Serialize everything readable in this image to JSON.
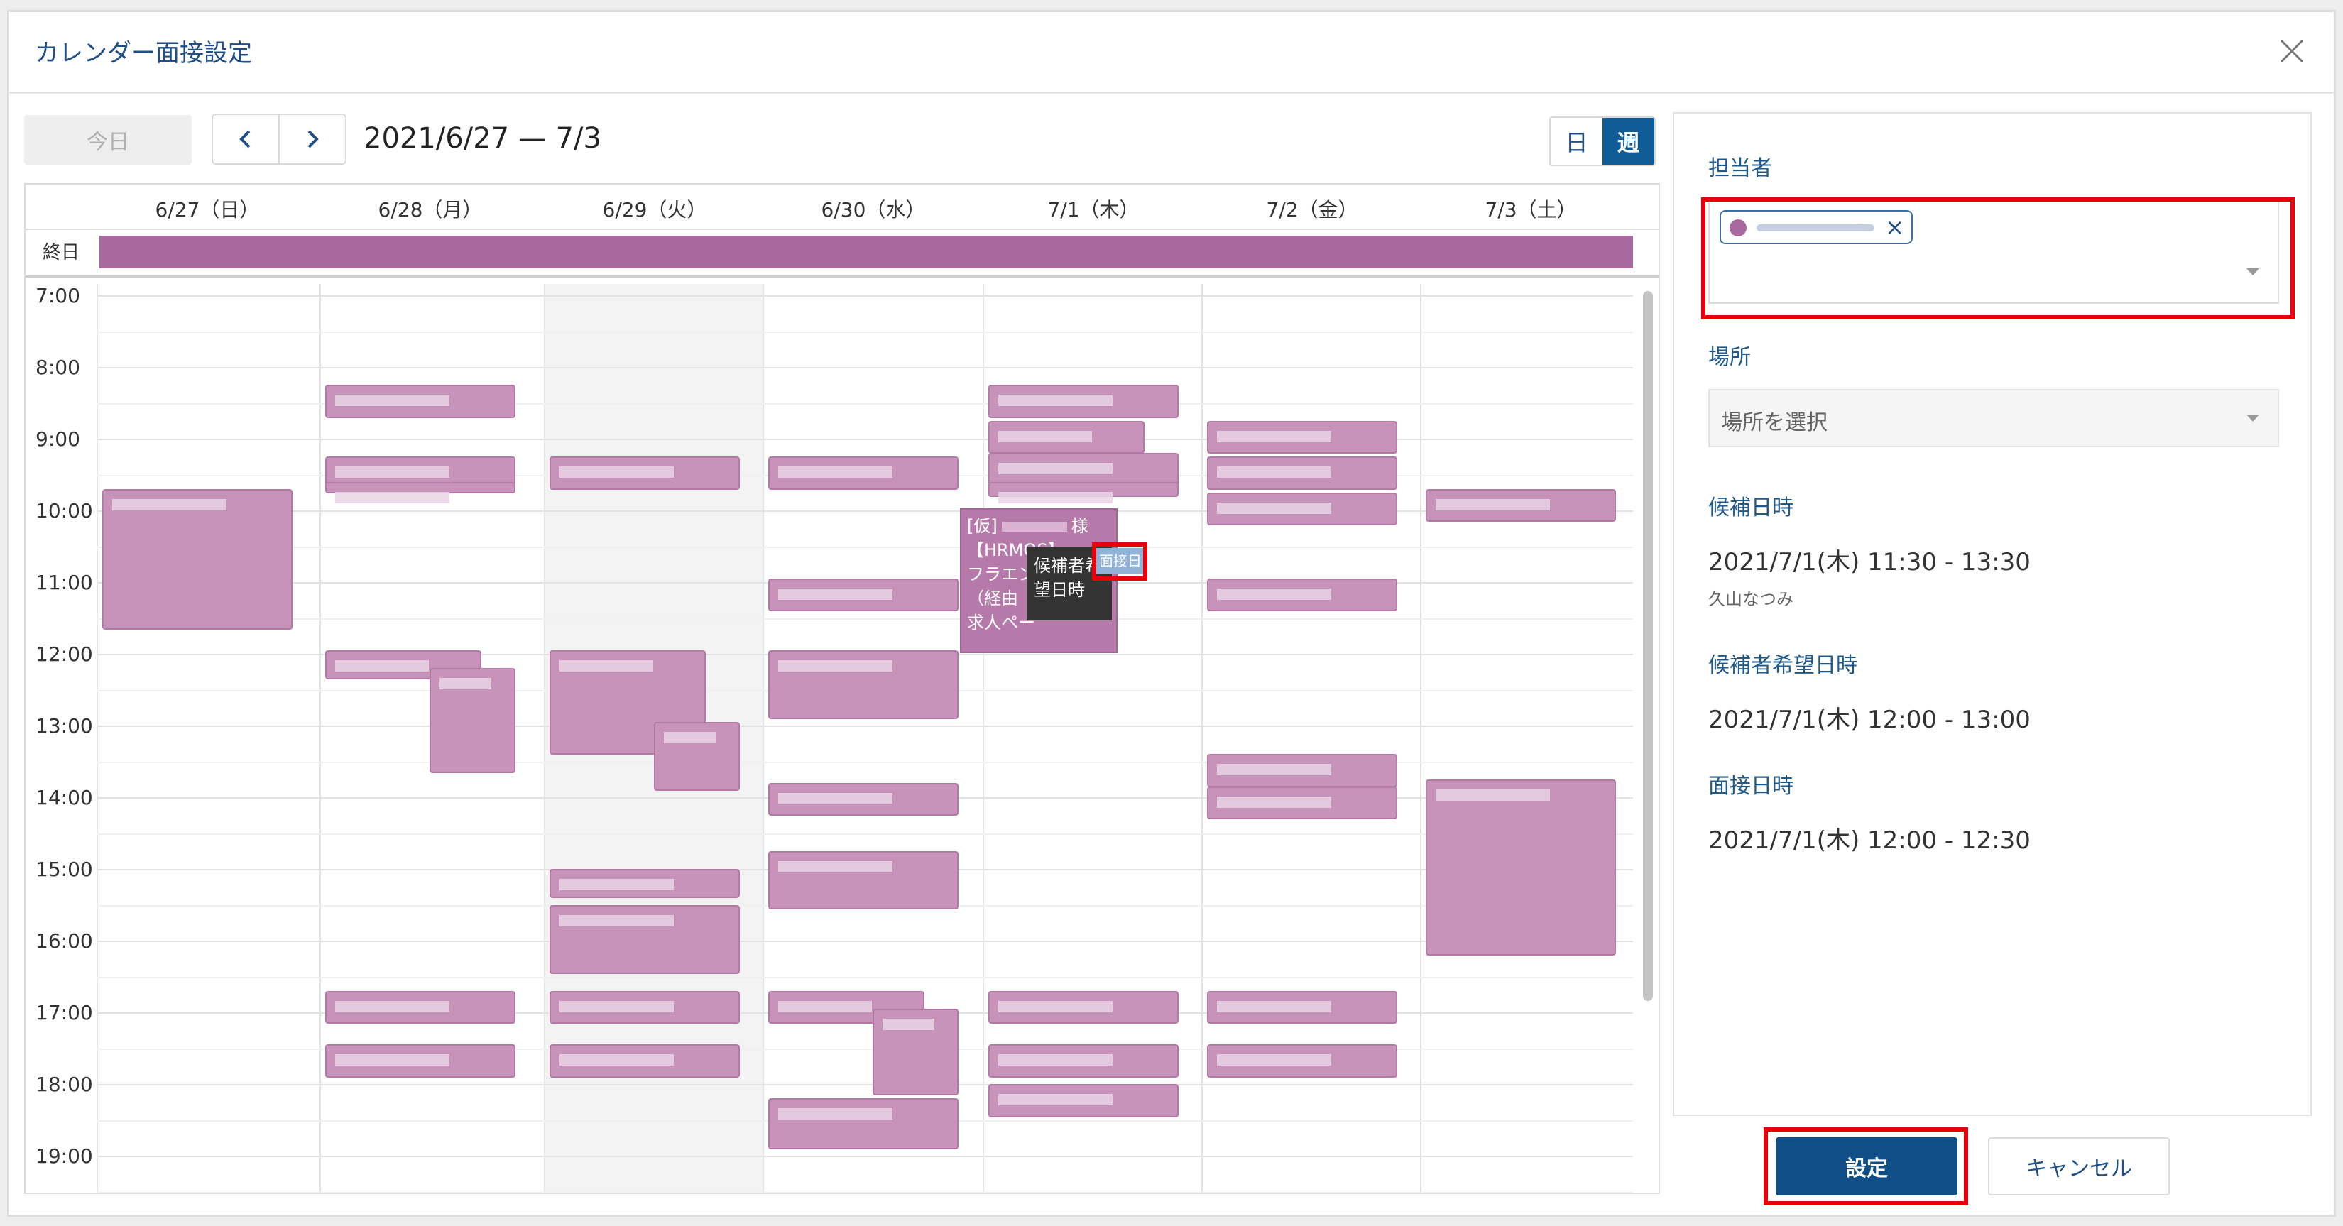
{
  "dialog": {
    "title": "カレンダー面接設定",
    "close_icon": "close-icon"
  },
  "toolbar": {
    "today_label": "今日",
    "prev_icon": "chevron-left-icon",
    "next_icon": "chevron-right-icon",
    "date_range": "2021/6/27 — 7/3",
    "view_day_label": "日",
    "view_week_label": "週",
    "active_view": "週"
  },
  "calendar": {
    "days": [
      "6/27（日）",
      "6/28（月）",
      "6/29（火）",
      "6/30（水）",
      "7/1（木）",
      "7/2（金）",
      "7/3（土）"
    ],
    "highlighted_day": "6/29（火）",
    "allday_label": "終日",
    "times": [
      "7:00",
      "8:00",
      "9:00",
      "10:00",
      "11:00",
      "12:00",
      "13:00",
      "14:00",
      "15:00",
      "16:00",
      "17:00",
      "18:00",
      "19:00"
    ],
    "selected_event": {
      "line1": "[仮]",
      "line1_suffix": "様",
      "line2": "【HRMOS】",
      "line3": "フラエン",
      "line4": "（経由",
      "line5": "求人ペー"
    },
    "tooltip": {
      "line1": "候補者希",
      "line2": "望日時"
    },
    "interview_tag": "面接日",
    "event_color": "#c793bb"
  },
  "panel": {
    "assignee_label": "担当者",
    "place_label": "場所",
    "place_placeholder": "場所を選択",
    "candidate_datetime_label": "候補日時",
    "candidate_datetime_value": "2021/7/1(木) 11:30 - 13:30",
    "candidate_person": "久山なつみ",
    "desired_datetime_label": "候補者希望日時",
    "desired_datetime_value": "2021/7/1(木) 12:00 - 13:00",
    "interview_datetime_label": "面接日時",
    "interview_datetime_value": "2021/7/1(木) 12:00 - 12:30"
  },
  "footer": {
    "set_label": "設定",
    "cancel_label": "キャンセル"
  },
  "colors": {
    "accent": "#0f4e86",
    "highlight": "#e8000b"
  }
}
